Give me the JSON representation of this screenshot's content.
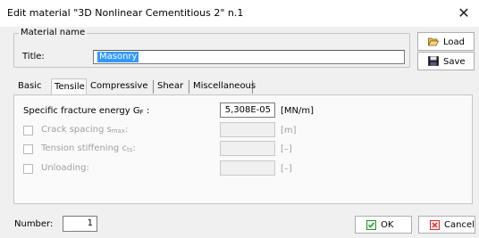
{
  "window": {
    "title": "Edit material  \"3D Nonlinear Cementitious 2\" n.1",
    "close_glyph": "✕"
  },
  "material_name": {
    "group_label": "Material name",
    "title_label": "Title:",
    "title_value": "Masonry"
  },
  "side_buttons": {
    "load_label": "Load",
    "save_label": "Save"
  },
  "tabs": [
    {
      "label": "Basic",
      "active": false
    },
    {
      "label": "Tensile",
      "active": true
    },
    {
      "label": "Compressive",
      "active": false
    },
    {
      "label": "Shear",
      "active": false
    },
    {
      "label": "Miscellaneous",
      "active": false
    }
  ],
  "tensile": {
    "fracture_energy": {
      "label_main": "Specific fracture energy G",
      "label_sub": "F",
      "label_tail": " :",
      "value": "5,308E-05",
      "unit": "[MN/m]"
    },
    "crack_spacing": {
      "label_main": "Crack spacing s",
      "label_sub": "max",
      "label_tail": ":",
      "value": "",
      "unit": "[m]",
      "checked": false,
      "enabled": false
    },
    "tension_stiffening": {
      "label_main": "Tension stiffening c",
      "label_sub": "ts",
      "label_tail": ":",
      "value": "",
      "unit": "[–]",
      "checked": false,
      "enabled": false
    },
    "unloading": {
      "label_main": "Unloading:",
      "value": "",
      "unit": "[–]",
      "checked": false,
      "enabled": false
    }
  },
  "footer": {
    "number_label": "Number:",
    "number_value": "1",
    "ok_label": "OK",
    "cancel_label": "Cancel"
  },
  "colors": {
    "selection": "#3399ff",
    "ok_icon": "#2e8b2e",
    "cancel_icon": "#d03030",
    "disabled_text": "#a0a0a0"
  }
}
